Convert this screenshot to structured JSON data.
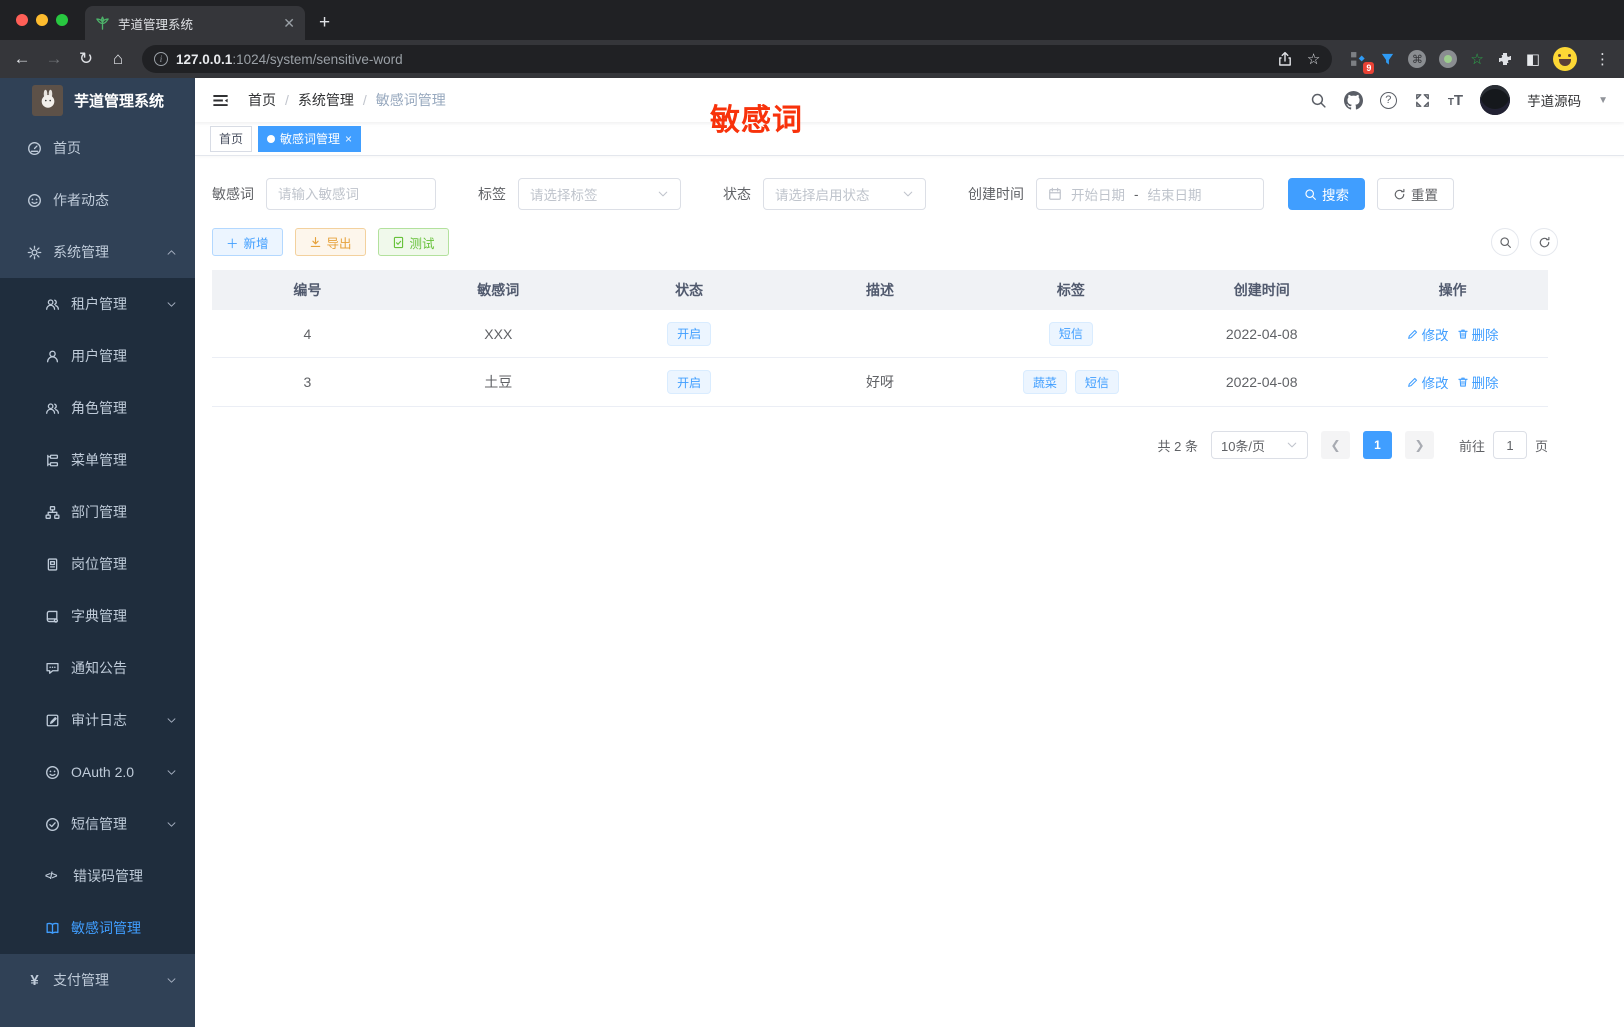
{
  "browser": {
    "tab_title": "芋道管理系统",
    "url_host": "127.0.0.1",
    "url_rest": ":1024/system/sensitive-word",
    "ext_badge": "9"
  },
  "sidebar": {
    "logo_title": "芋道管理系统",
    "items": [
      {
        "label": "首页"
      },
      {
        "label": "作者动态"
      },
      {
        "label": "系统管理"
      },
      {
        "label": "租户管理"
      },
      {
        "label": "用户管理"
      },
      {
        "label": "角色管理"
      },
      {
        "label": "菜单管理"
      },
      {
        "label": "部门管理"
      },
      {
        "label": "岗位管理"
      },
      {
        "label": "字典管理"
      },
      {
        "label": "通知公告"
      },
      {
        "label": "审计日志"
      },
      {
        "label": "OAuth 2.0"
      },
      {
        "label": "短信管理"
      },
      {
        "label": "错误码管理"
      },
      {
        "label": "敏感词管理"
      },
      {
        "label": "支付管理"
      }
    ]
  },
  "header": {
    "breadcrumb": {
      "home": "首页",
      "section": "系统管理",
      "current": "敏感词管理"
    },
    "overlay_text": "敏感词",
    "username": "芋道源码"
  },
  "tags_bar": {
    "home": "首页",
    "active": "敏感词管理"
  },
  "filters": {
    "keyword_label": "敏感词",
    "keyword_placeholder": "请输入敏感词",
    "tag_label": "标签",
    "tag_placeholder": "请选择标签",
    "status_label": "状态",
    "status_placeholder": "请选择启用状态",
    "date_label": "创建时间",
    "date_start": "开始日期",
    "date_sep": "-",
    "date_end": "结束日期",
    "search_label": "搜索",
    "reset_label": "重置"
  },
  "toolbar": {
    "add": "新增",
    "export": "导出",
    "test": "测试"
  },
  "table": {
    "headers": [
      "编号",
      "敏感词",
      "状态",
      "描述",
      "标签",
      "创建时间",
      "操作"
    ],
    "edit_label": "修改",
    "delete_label": "删除",
    "rows": [
      {
        "id": "4",
        "word": "XXX",
        "status": "开启",
        "desc": "",
        "tags": [
          "短信"
        ],
        "created": "2022-04-08"
      },
      {
        "id": "3",
        "word": "土豆",
        "status": "开启",
        "desc": "好呀",
        "tags": [
          "蔬菜",
          "短信"
        ],
        "created": "2022-04-08"
      }
    ]
  },
  "pagination": {
    "total": "共 2 条",
    "page_size": "10条/页",
    "page": "1",
    "goto": "前往",
    "goto_value": "1",
    "unit": "页"
  },
  "colors": {
    "accent": "#409eff",
    "overlay_red": "#f8320b"
  }
}
